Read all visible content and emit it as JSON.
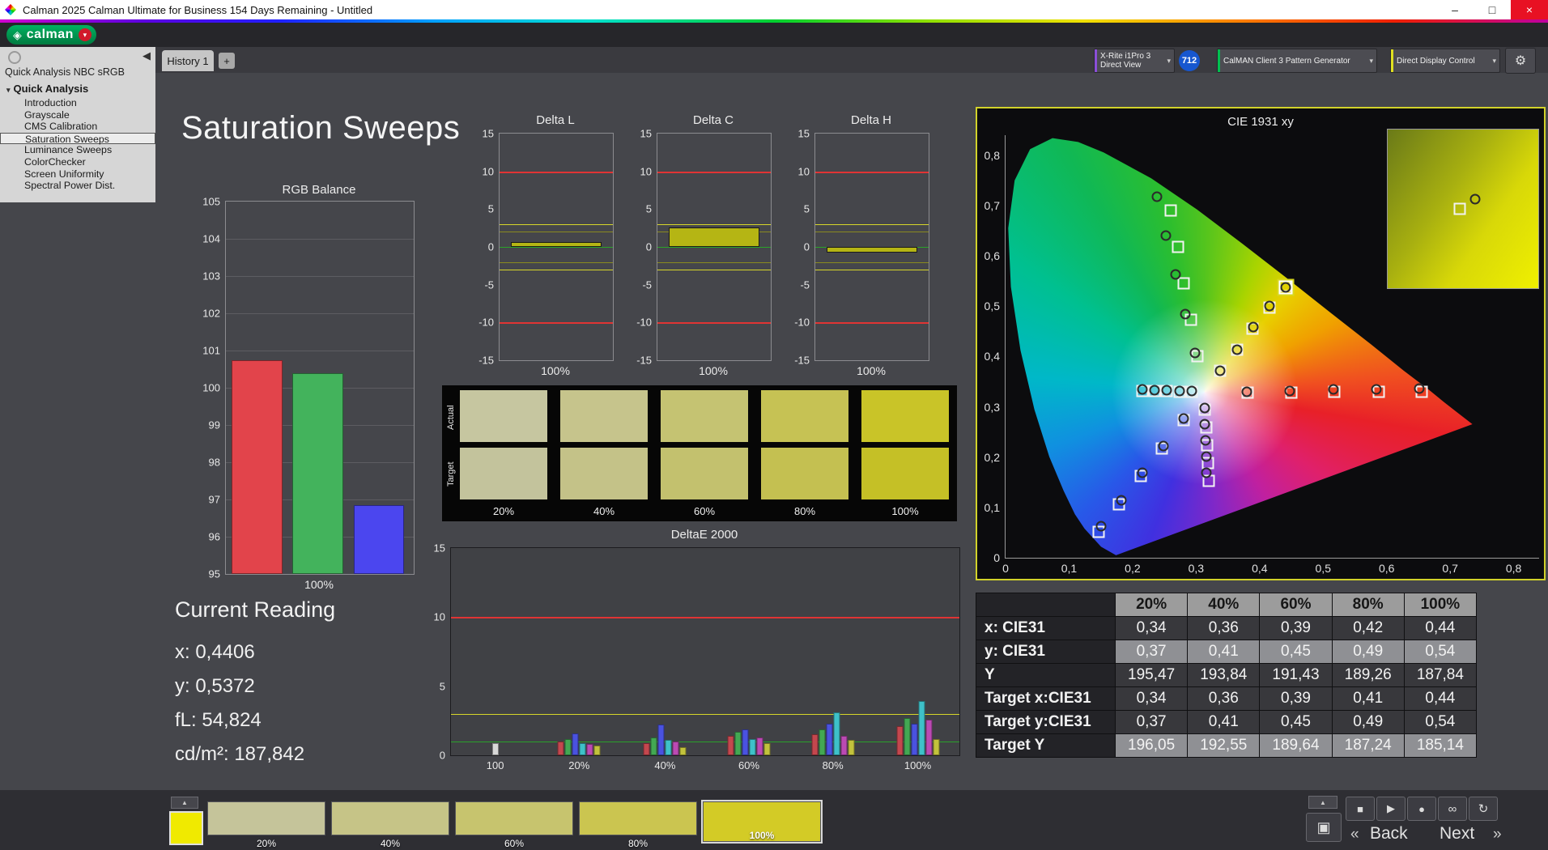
{
  "window": {
    "title": "Calman 2025 Calman Ultimate for Business 154 Days Remaining  - Untitled",
    "minimize": "–",
    "maximize": "□",
    "close": "×"
  },
  "brand": {
    "logo_text": "calman",
    "logo_mark": "◈",
    "menu_chevron": "▾"
  },
  "tabs": {
    "history": "History 1",
    "add_tab": "+"
  },
  "toolbar": {
    "meter_line1": "X-Rite i1Pro 3",
    "meter_line2": "Direct View",
    "meter_badge": "712",
    "generator": "CalMAN Client 3 Pattern Generator",
    "display_control": "Direct Display Control",
    "gear": "⚙",
    "chevron": "▾"
  },
  "sidebar": {
    "collapse": "◀",
    "title": "Quick Analysis NBC sRGB",
    "root": "Quick Analysis",
    "root_expander": "▾",
    "items": [
      "Introduction",
      "Grayscale",
      "CMS Calibration",
      "Saturation Sweeps",
      "Luminance Sweeps",
      "ColorChecker",
      "Screen Uniformity",
      "Spectral Power Dist."
    ],
    "selected": "Saturation Sweeps"
  },
  "page": {
    "title": "Saturation Sweeps"
  },
  "current_reading": {
    "heading": "Current Reading",
    "x": "x: 0,4406",
    "y": "y: 0,5372",
    "fl": "fL: 54,824",
    "cdm2": "cd/m²: 187,842"
  },
  "swatch_grid": {
    "row_labels": [
      "Actual",
      "Target"
    ],
    "col_labels": [
      "20%",
      "40%",
      "60%",
      "80%",
      "100%"
    ],
    "actual": [
      "#c6c6a0",
      "#c6c48c",
      "#c5c372",
      "#c6c254",
      "#c9c428"
    ],
    "target": [
      "#c3c39c",
      "#c4c288",
      "#c3c16e",
      "#c4c051",
      "#c5c026"
    ]
  },
  "table": {
    "corner": "",
    "headers": [
      "20%",
      "40%",
      "60%",
      "80%",
      "100%"
    ],
    "rows": [
      {
        "label": "x: CIE31",
        "values": [
          "0,34",
          "0,36",
          "0,39",
          "0,42",
          "0,44"
        ],
        "light": false
      },
      {
        "label": "y: CIE31",
        "values": [
          "0,37",
          "0,41",
          "0,45",
          "0,49",
          "0,54"
        ],
        "light": true
      },
      {
        "label": "Y",
        "values": [
          "195,47",
          "193,84",
          "191,43",
          "189,26",
          "187,84"
        ],
        "light": false
      },
      {
        "label": "Target x:CIE31",
        "values": [
          "0,34",
          "0,36",
          "0,39",
          "0,41",
          "0,44"
        ],
        "light": false
      },
      {
        "label": "Target y:CIE31",
        "values": [
          "0,37",
          "0,41",
          "0,45",
          "0,49",
          "0,54"
        ],
        "light": false
      },
      {
        "label": "Target Y",
        "values": [
          "196,05",
          "192,55",
          "189,64",
          "187,24",
          "185,14"
        ],
        "light": true
      }
    ]
  },
  "bottom_bar": {
    "collapse_up": "▲",
    "active_swatch_color": "#f0ea00",
    "patches": [
      {
        "label": "20%",
        "color": "#c5c49a",
        "selected": false
      },
      {
        "label": "40%",
        "color": "#c6c487",
        "selected": false
      },
      {
        "label": "60%",
        "color": "#c7c46e",
        "selected": false
      },
      {
        "label": "80%",
        "color": "#cbc550",
        "selected": false
      },
      {
        "label": "100%",
        "color": "#d3cb26",
        "selected": true
      }
    ],
    "transport": {
      "pattern_window": "▣",
      "stop": "■",
      "play": "▶",
      "record": "●",
      "loop": "∞",
      "refresh": "↻"
    },
    "back_chevron": "«",
    "back": "Back",
    "next": "Next",
    "next_chevron": "»"
  },
  "chart_data": [
    {
      "id": "rgb_balance",
      "type": "bar",
      "title": "RGB Balance",
      "categories": [
        "Red",
        "Green",
        "Blue"
      ],
      "values": [
        100.75,
        100.4,
        96.85
      ],
      "colors": [
        "#e2444b",
        "#43b35c",
        "#4b46ef"
      ],
      "ylim": [
        95,
        105
      ],
      "yticks": [
        105,
        104,
        103,
        102,
        101,
        100,
        99,
        98,
        97,
        96,
        95
      ],
      "xlabel": "100%"
    },
    {
      "id": "delta_l",
      "type": "bar",
      "title": "Delta L",
      "xlabel": "100%",
      "ylim": [
        -15,
        15
      ],
      "yticks": [
        15,
        10,
        5,
        0,
        -5,
        -10,
        -15
      ],
      "value": 0.6,
      "bar_color": "#b5b514",
      "ref_lines": [
        {
          "y": 10,
          "color": "#e03434"
        },
        {
          "y": -10,
          "color": "#e03434"
        },
        {
          "y": 3,
          "color": "#d6d62a"
        },
        {
          "y": -3,
          "color": "#d6d62a"
        },
        {
          "y": 2,
          "color": "#8a8a20"
        },
        {
          "y": -2,
          "color": "#8a8a20"
        },
        {
          "y": 0,
          "color": "#2aa22a"
        }
      ]
    },
    {
      "id": "delta_c",
      "type": "bar",
      "title": "Delta C",
      "xlabel": "100%",
      "ylim": [
        -15,
        15
      ],
      "yticks": [
        15,
        10,
        5,
        0,
        -5,
        -10,
        -15
      ],
      "value": 2.6,
      "bar_color": "#b5b514",
      "ref_lines": [
        {
          "y": 10,
          "color": "#e03434"
        },
        {
          "y": -10,
          "color": "#e03434"
        },
        {
          "y": 3,
          "color": "#d6d62a"
        },
        {
          "y": -3,
          "color": "#d6d62a"
        },
        {
          "y": 2,
          "color": "#8a8a20"
        },
        {
          "y": -2,
          "color": "#8a8a20"
        },
        {
          "y": 0,
          "color": "#2aa22a"
        }
      ]
    },
    {
      "id": "delta_h",
      "type": "bar",
      "title": "Delta H",
      "xlabel": "100%",
      "ylim": [
        -15,
        15
      ],
      "yticks": [
        15,
        10,
        5,
        0,
        -5,
        -10,
        -15
      ],
      "value": -0.8,
      "bar_color": "#b5b514",
      "ref_lines": [
        {
          "y": 10,
          "color": "#e03434"
        },
        {
          "y": -10,
          "color": "#e03434"
        },
        {
          "y": 3,
          "color": "#d6d62a"
        },
        {
          "y": -3,
          "color": "#d6d62a"
        },
        {
          "y": 2,
          "color": "#8a8a20"
        },
        {
          "y": -2,
          "color": "#8a8a20"
        },
        {
          "y": 0,
          "color": "#2aa22a"
        }
      ]
    },
    {
      "id": "deltae2000",
      "type": "grouped-bar",
      "title": "DeltaE 2000",
      "ylim": [
        0,
        15
      ],
      "yticks": [
        15,
        10,
        5,
        0
      ],
      "ref_lines": [
        {
          "y": 10,
          "color": "#e03434"
        },
        {
          "y": 3,
          "color": "#d6d62a"
        },
        {
          "y": 1,
          "color": "#2aa22a"
        }
      ],
      "groups": [
        {
          "tick": "100",
          "x": 0.087,
          "bars": [
            {
              "v": 0.9,
              "c": "#d8d8d8"
            }
          ]
        },
        {
          "tick": "20%",
          "x": 0.252,
          "bars": [
            {
              "v": 1.0,
              "c": "#c4474e"
            },
            {
              "v": 1.2,
              "c": "#43a853"
            },
            {
              "v": 1.6,
              "c": "#4a52e0"
            },
            {
              "v": 0.9,
              "c": "#3ec1c9"
            },
            {
              "v": 0.8,
              "c": "#bb4ab3"
            },
            {
              "v": 0.7,
              "c": "#c2c23c"
            }
          ]
        },
        {
          "tick": "40%",
          "x": 0.421,
          "bars": [
            {
              "v": 0.9,
              "c": "#c4474e"
            },
            {
              "v": 1.3,
              "c": "#43a853"
            },
            {
              "v": 2.2,
              "c": "#4a52e0"
            },
            {
              "v": 1.1,
              "c": "#3ec1c9"
            },
            {
              "v": 1.0,
              "c": "#bb4ab3"
            },
            {
              "v": 0.6,
              "c": "#c2c23c"
            }
          ]
        },
        {
          "tick": "60%",
          "x": 0.586,
          "bars": [
            {
              "v": 1.4,
              "c": "#c4474e"
            },
            {
              "v": 1.7,
              "c": "#43a853"
            },
            {
              "v": 1.9,
              "c": "#4a52e0"
            },
            {
              "v": 1.2,
              "c": "#3ec1c9"
            },
            {
              "v": 1.3,
              "c": "#bb4ab3"
            },
            {
              "v": 0.9,
              "c": "#c2c23c"
            }
          ]
        },
        {
          "tick": "80%",
          "x": 0.751,
          "bars": [
            {
              "v": 1.5,
              "c": "#c4474e"
            },
            {
              "v": 1.9,
              "c": "#43a853"
            },
            {
              "v": 2.3,
              "c": "#4a52e0"
            },
            {
              "v": 3.1,
              "c": "#3ec1c9"
            },
            {
              "v": 1.4,
              "c": "#bb4ab3"
            },
            {
              "v": 1.1,
              "c": "#c2c23c"
            }
          ]
        },
        {
          "tick": "100%",
          "x": 0.918,
          "bars": [
            {
              "v": 2.1,
              "c": "#c4474e"
            },
            {
              "v": 2.7,
              "c": "#43a853"
            },
            {
              "v": 2.3,
              "c": "#4a52e0"
            },
            {
              "v": 3.9,
              "c": "#3ec1c9"
            },
            {
              "v": 2.6,
              "c": "#bb4ab3"
            },
            {
              "v": 1.2,
              "c": "#c2c23c"
            }
          ]
        }
      ]
    },
    {
      "id": "cie1931",
      "type": "scatter",
      "title": "CIE 1931 xy",
      "axis_max": 0.84,
      "xticks": [
        {
          "v": 0,
          "t": "0"
        },
        {
          "v": 0.1,
          "t": "0,1"
        },
        {
          "v": 0.2,
          "t": "0,2"
        },
        {
          "v": 0.3,
          "t": "0,3"
        },
        {
          "v": 0.4,
          "t": "0,4"
        },
        {
          "v": 0.5,
          "t": "0,5"
        },
        {
          "v": 0.6,
          "t": "0,6"
        },
        {
          "v": 0.7,
          "t": "0,7"
        },
        {
          "v": 0.8,
          "t": "0,8"
        }
      ],
      "yticks": [
        {
          "v": 0,
          "t": "0"
        },
        {
          "v": 0.1,
          "t": "0,1"
        },
        {
          "v": 0.2,
          "t": "0,2"
        },
        {
          "v": 0.3,
          "t": "0,3"
        },
        {
          "v": 0.4,
          "t": "0,4"
        },
        {
          "v": 0.5,
          "t": "0,5"
        },
        {
          "v": 0.6,
          "t": "0,6"
        },
        {
          "v": 0.7,
          "t": "0,7"
        },
        {
          "v": 0.8,
          "t": "0,8"
        }
      ],
      "targets": [
        [
          0.381,
          0.329
        ],
        [
          0.45,
          0.329
        ],
        [
          0.518,
          0.33
        ],
        [
          0.587,
          0.33
        ],
        [
          0.655,
          0.33
        ],
        [
          0.302,
          0.401
        ],
        [
          0.292,
          0.473
        ],
        [
          0.281,
          0.546
        ],
        [
          0.271,
          0.618
        ],
        [
          0.26,
          0.69
        ],
        [
          0.28,
          0.274
        ],
        [
          0.246,
          0.218
        ],
        [
          0.213,
          0.163
        ],
        [
          0.179,
          0.107
        ],
        [
          0.146,
          0.052
        ],
        [
          0.293,
          0.33
        ],
        [
          0.274,
          0.33
        ],
        [
          0.254,
          0.331
        ],
        [
          0.235,
          0.331
        ],
        [
          0.215,
          0.332
        ],
        [
          0.314,
          0.294
        ],
        [
          0.316,
          0.259
        ],
        [
          0.317,
          0.223
        ],
        [
          0.319,
          0.188
        ],
        [
          0.32,
          0.153
        ],
        [
          0.338,
          0.371
        ],
        [
          0.364,
          0.413
        ],
        [
          0.389,
          0.456
        ],
        [
          0.415,
          0.498
        ],
        [
          0.44,
          0.54
        ]
      ],
      "measured": [
        [
          0.38,
          0.33
        ],
        [
          0.448,
          0.332
        ],
        [
          0.516,
          0.334
        ],
        [
          0.584,
          0.335
        ],
        [
          0.651,
          0.336
        ],
        [
          0.298,
          0.407
        ],
        [
          0.283,
          0.484
        ],
        [
          0.268,
          0.563
        ],
        [
          0.253,
          0.64
        ],
        [
          0.238,
          0.718
        ],
        [
          0.281,
          0.276
        ],
        [
          0.248,
          0.222
        ],
        [
          0.215,
          0.169
        ],
        [
          0.182,
          0.115
        ],
        [
          0.15,
          0.062
        ],
        [
          0.293,
          0.331
        ],
        [
          0.274,
          0.331
        ],
        [
          0.254,
          0.333
        ],
        [
          0.235,
          0.333
        ],
        [
          0.215,
          0.335
        ],
        [
          0.313,
          0.297
        ],
        [
          0.314,
          0.265
        ],
        [
          0.315,
          0.233
        ],
        [
          0.316,
          0.201
        ],
        [
          0.316,
          0.169
        ],
        [
          0.338,
          0.372
        ],
        [
          0.364,
          0.414
        ],
        [
          0.39,
          0.458
        ],
        [
          0.416,
          0.5
        ],
        [
          0.4406,
          0.5372
        ]
      ],
      "current": [
        0.4406,
        0.5372
      ]
    }
  ]
}
